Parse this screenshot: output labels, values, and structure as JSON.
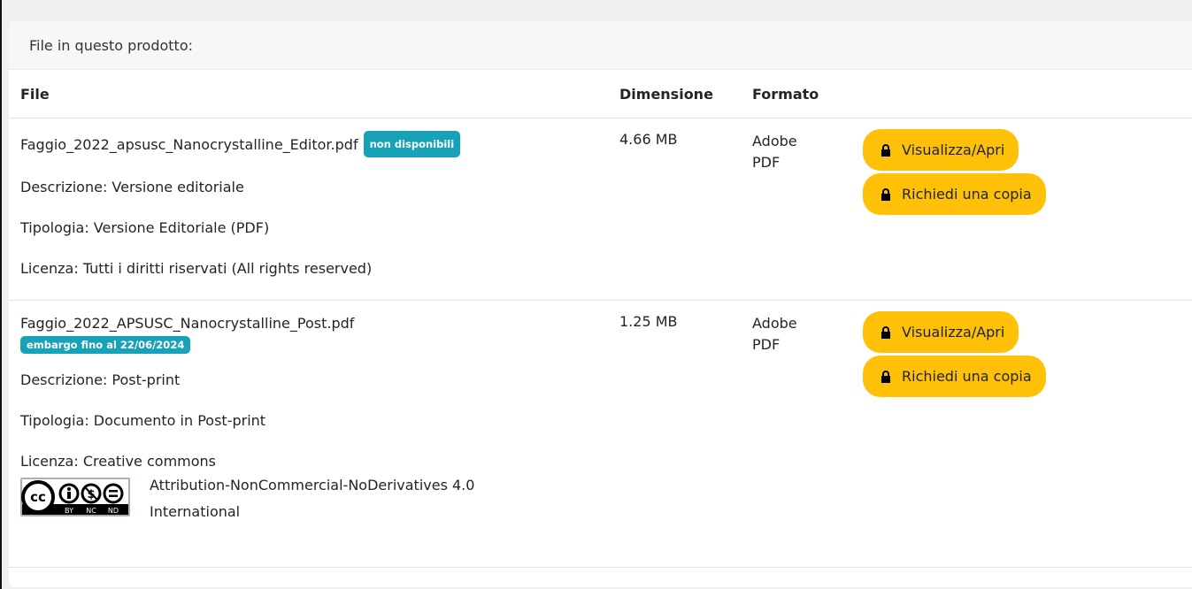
{
  "panel": {
    "header": "File in questo prodotto:"
  },
  "table": {
    "headers": {
      "file": "File",
      "size": "Dimensione",
      "format": "Formato"
    },
    "rows": [
      {
        "filename": "Faggio_2022_apsusc_Nanocrystalline_Editor.pdf",
        "badge": "non disponibili",
        "description": "Descrizione: Versione editoriale",
        "type": "Tipologia: Versione Editoriale (PDF)",
        "license": "Licenza: Tutti i diritti riservati (All rights reserved)",
        "size": "4.66 MB",
        "format_line1": "Adobe",
        "format_line2": "PDF",
        "view_label": "Visualizza/Apri",
        "request_label": "Richiedi una copia"
      },
      {
        "filename": "Faggio_2022_APSUSC_Nanocrystalline_Post.pdf",
        "badge": "embargo fino al 22/06/2024",
        "description": "Descrizione: Post-print",
        "type": "Tipologia: Documento in Post-print",
        "license": "Licenza: Creative commons",
        "license_detail_line1": "Attribution-NonCommercial-NoDerivatives 4.0",
        "license_detail_line2": "International",
        "size": "1.25 MB",
        "format_line1": "Adobe",
        "format_line2": "PDF",
        "view_label": "Visualizza/Apri",
        "request_label": "Richiedi una copia"
      }
    ]
  },
  "cc_logo": {
    "icon": "cc-by-nc-nd-icon",
    "subtext": [
      "BY",
      "NC",
      "ND"
    ]
  },
  "colors": {
    "badge": "#17a2b8",
    "button": "#ffc107",
    "header_bg": "#f7f7f7"
  }
}
